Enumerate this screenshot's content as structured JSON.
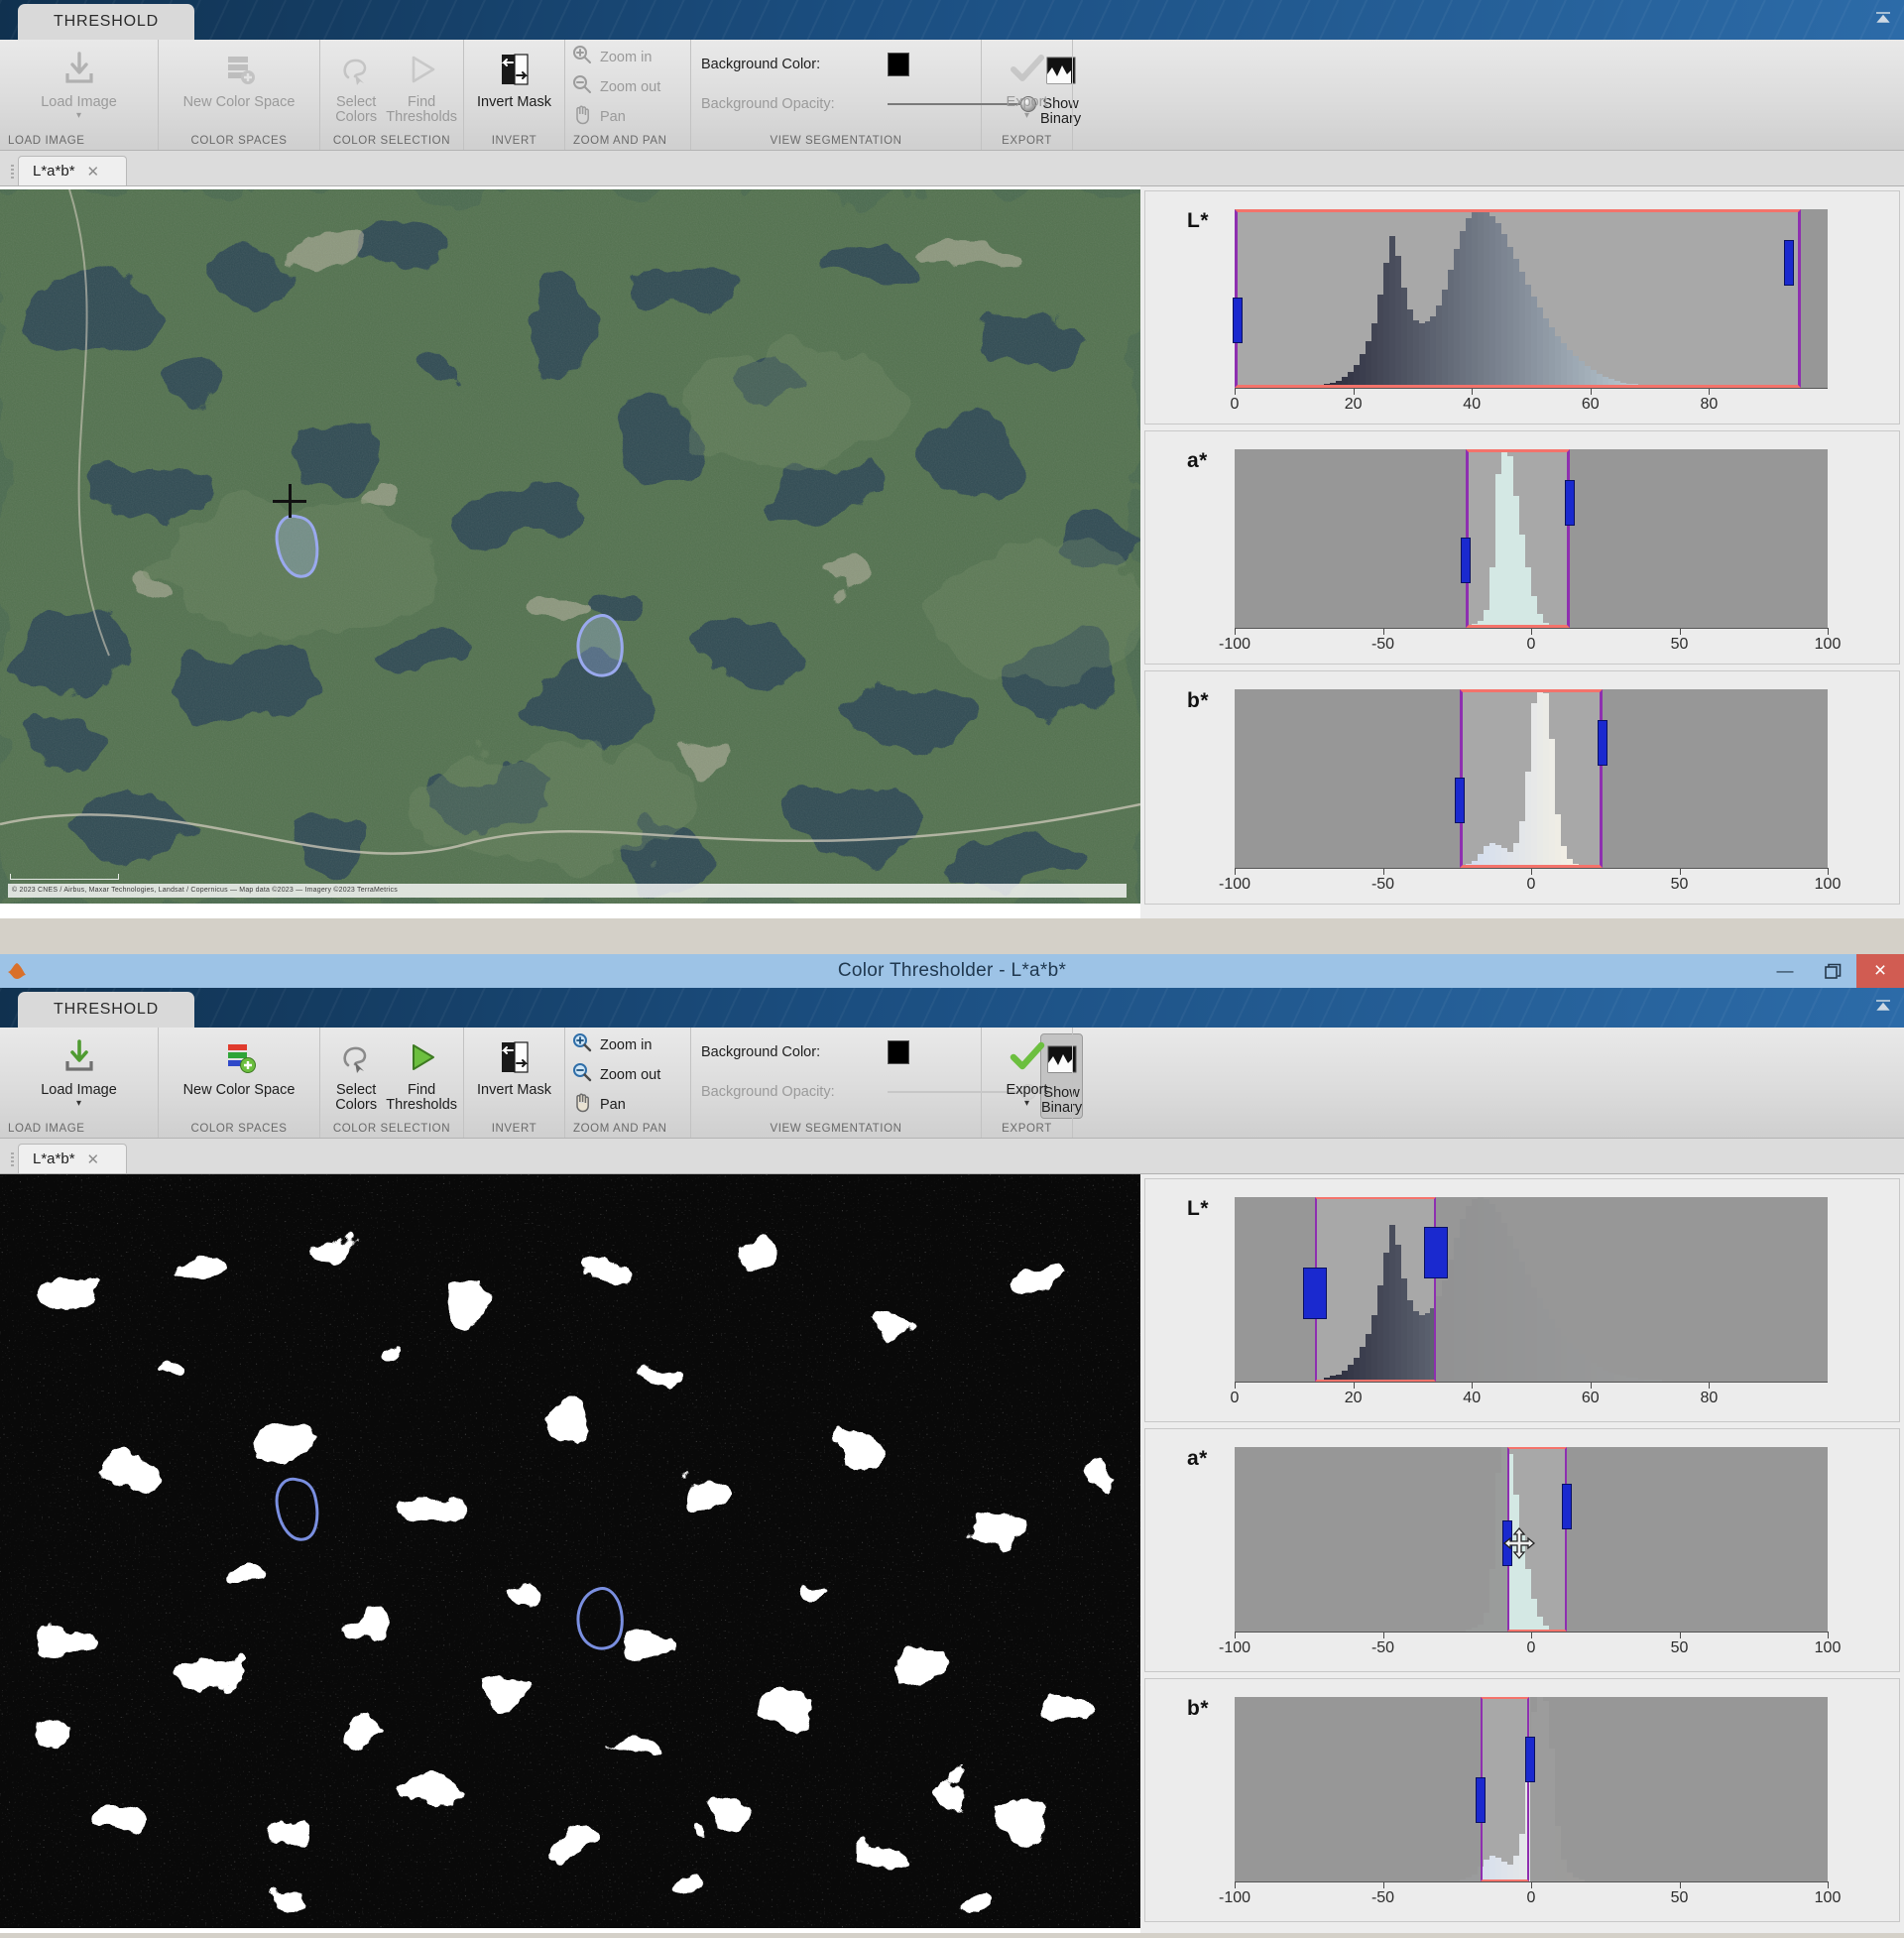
{
  "app": {
    "title": "Color Thresholder - L*a*b*",
    "icon": "matlab-icon"
  },
  "window_controls": {
    "minimize": "—",
    "restore": "restore-icon",
    "close": "×"
  },
  "ribbon": {
    "tab_label": "THRESHOLD",
    "collapse_icon": "collapse-ribbon-icon",
    "groups": [
      {
        "title": "LOAD IMAGE",
        "buttons": [
          {
            "label": "Load Image",
            "icon": "load-image-icon",
            "caret": "▾"
          }
        ]
      },
      {
        "title": "COLOR SPACES",
        "buttons": [
          {
            "label": "New Color Space",
            "icon": "new-color-space-icon"
          }
        ]
      },
      {
        "title": "COLOR SELECTION",
        "buttons": [
          {
            "label": "Select Colors",
            "icon": "select-colors-icon"
          },
          {
            "label": "Find Thresholds",
            "icon": "find-thresholds-icon"
          }
        ]
      },
      {
        "title": "INVERT",
        "buttons": [
          {
            "label": "Invert Mask",
            "icon": "invert-mask-icon"
          }
        ]
      },
      {
        "title": "ZOOM AND PAN",
        "items": [
          {
            "label": "Zoom in",
            "icon": "zoom-in-icon"
          },
          {
            "label": "Zoom out",
            "icon": "zoom-out-icon"
          },
          {
            "label": "Pan",
            "icon": "pan-hand-icon"
          }
        ]
      },
      {
        "title": "VIEW SEGMENTATION",
        "bg_color_label": "Background Color:",
        "bg_color_value": "#000000",
        "bg_opacity_label": "Background Opacity:",
        "show_binary_label": "Show Binary",
        "show_binary_icon": "show-binary-icon"
      },
      {
        "title": "EXPORT",
        "buttons": [
          {
            "label": "Export",
            "icon": "export-check-icon",
            "caret": "▾"
          }
        ]
      }
    ]
  },
  "doc_tab": {
    "label": "L*a*b*",
    "close": "✕"
  },
  "image_view": {
    "top_mode": "satellite-color-image",
    "bottom_mode": "binary-mask-image",
    "attribution": "© 2023 CNES / Airbus, Maxar Technologies, Landsat / Copernicus  —  Map data ©2023  —  Imagery ©2023 TerraMetrics",
    "cursor_top": "crosshair-cursor",
    "roi_shapes": 2
  },
  "chart_data": [
    {
      "id": "top-L",
      "type": "bar",
      "title": "L*",
      "xlabel": "",
      "ylabel": "",
      "xlim": [
        0,
        100
      ],
      "xticks": [
        0,
        20,
        40,
        60,
        80
      ],
      "grid": false,
      "roi": {
        "min": 0,
        "max": 95.5
      },
      "handles": [
        0.5,
        93.5
      ],
      "bin_start": 0,
      "bin_step": 1,
      "values": [
        0,
        0,
        0,
        0,
        0,
        0,
        0,
        0,
        0,
        0,
        0,
        0,
        0,
        0,
        1,
        2,
        3,
        4,
        6,
        9,
        13,
        19,
        26,
        36,
        52,
        70,
        85,
        74,
        56,
        44,
        38,
        36,
        37,
        40,
        46,
        55,
        66,
        78,
        88,
        95,
        99,
        100,
        99,
        96,
        92,
        86,
        79,
        72,
        65,
        58,
        51,
        45,
        39,
        34,
        29,
        25,
        21,
        18,
        15,
        12,
        10,
        8,
        6,
        5,
        4,
        3,
        2,
        2,
        1,
        1,
        1,
        1,
        0,
        0,
        0,
        0,
        0,
        0,
        0,
        0,
        0,
        0,
        0,
        0,
        0,
        0,
        0,
        0,
        0,
        0,
        0,
        0,
        0,
        0,
        0,
        0,
        0,
        0,
        0,
        0
      ]
    },
    {
      "id": "top-a",
      "type": "bar",
      "title": "a*",
      "xlabel": "",
      "ylabel": "",
      "xlim": [
        -100,
        100
      ],
      "xticks": [
        -100,
        -50,
        0,
        50,
        100
      ],
      "grid": false,
      "roi": {
        "min": -22,
        "max": 13
      },
      "handles": [
        -22,
        13
      ],
      "bin_start": -100,
      "bin_step": 2,
      "values": [
        0,
        0,
        0,
        0,
        0,
        0,
        0,
        0,
        0,
        0,
        0,
        0,
        0,
        0,
        0,
        0,
        0,
        0,
        0,
        0,
        0,
        0,
        0,
        0,
        0,
        0,
        0,
        0,
        0,
        0,
        0,
        0,
        0,
        0,
        0,
        0,
        0,
        0,
        0,
        1,
        2,
        4,
        10,
        34,
        86,
        100,
        96,
        74,
        52,
        34,
        18,
        8,
        3,
        1,
        0,
        0,
        0,
        0,
        0,
        0,
        0,
        0,
        0,
        0,
        0,
        0,
        0,
        0,
        0,
        0,
        0,
        0,
        0,
        0,
        0,
        0,
        0,
        0,
        0,
        0,
        0,
        0,
        0,
        0,
        0,
        0,
        0,
        0,
        0,
        0,
        0,
        0,
        0,
        0,
        0,
        0,
        0,
        0,
        0,
        0
      ]
    },
    {
      "id": "top-b",
      "type": "bar",
      "title": "b*",
      "xlabel": "",
      "ylabel": "",
      "xlim": [
        -100,
        100
      ],
      "xticks": [
        -100,
        -50,
        0,
        50,
        100
      ],
      "grid": false,
      "roi": {
        "min": -24,
        "max": 24
      },
      "handles": [
        -24,
        24
      ],
      "bin_start": -100,
      "bin_step": 2,
      "values": [
        0,
        0,
        0,
        0,
        0,
        0,
        0,
        0,
        0,
        0,
        0,
        0,
        0,
        0,
        0,
        0,
        0,
        0,
        0,
        0,
        0,
        0,
        0,
        0,
        0,
        0,
        0,
        0,
        0,
        0,
        0,
        0,
        0,
        0,
        0,
        0,
        0,
        0,
        1,
        2,
        4,
        8,
        12,
        14,
        13,
        11,
        9,
        14,
        26,
        54,
        92,
        100,
        98,
        72,
        30,
        12,
        5,
        2,
        1,
        0,
        0,
        0,
        0,
        0,
        0,
        0,
        0,
        0,
        0,
        0,
        0,
        0,
        0,
        0,
        0,
        0,
        0,
        0,
        0,
        0,
        0,
        0,
        0,
        0,
        0,
        0,
        0,
        0,
        0,
        0,
        0,
        0,
        0,
        0,
        0,
        0,
        0,
        0,
        0,
        0
      ]
    },
    {
      "id": "bottom-L",
      "type": "bar",
      "title": "L*",
      "xlabel": "",
      "ylabel": "",
      "xlim": [
        0,
        100
      ],
      "xticks": [
        0,
        20,
        40,
        60,
        80
      ],
      "grid": false,
      "roi": {
        "min": 13.5,
        "max": 34
      },
      "handles": [
        13.5,
        34
      ],
      "bin_start": 0,
      "bin_step": 1,
      "values": [
        0,
        0,
        0,
        0,
        0,
        0,
        0,
        0,
        0,
        0,
        0,
        0,
        0,
        0,
        1,
        2,
        3,
        4,
        6,
        9,
        13,
        19,
        26,
        36,
        52,
        70,
        85,
        74,
        56,
        44,
        38,
        36,
        37,
        40,
        46,
        55,
        66,
        78,
        88,
        95,
        99,
        100,
        99,
        96,
        92,
        86,
        79,
        72,
        65,
        58,
        51,
        45,
        39,
        34,
        29,
        25,
        21,
        18,
        15,
        12,
        10,
        8,
        6,
        5,
        4,
        3,
        2,
        2,
        1,
        1,
        1,
        1,
        0,
        0,
        0,
        0,
        0,
        0,
        0,
        0,
        0,
        0,
        0,
        0,
        0,
        0,
        0,
        0,
        0,
        0,
        0,
        0,
        0,
        0,
        0,
        0,
        0,
        0,
        0,
        0
      ]
    },
    {
      "id": "bottom-a",
      "type": "bar",
      "title": "a*",
      "xlabel": "",
      "ylabel": "",
      "xlim": [
        -100,
        100
      ],
      "xticks": [
        -100,
        -50,
        0,
        50,
        100
      ],
      "grid": false,
      "roi": {
        "min": -8,
        "max": 12
      },
      "handles": [
        -8,
        12
      ],
      "bin_start": -100,
      "bin_step": 2,
      "values": [
        0,
        0,
        0,
        0,
        0,
        0,
        0,
        0,
        0,
        0,
        0,
        0,
        0,
        0,
        0,
        0,
        0,
        0,
        0,
        0,
        0,
        0,
        0,
        0,
        0,
        0,
        0,
        0,
        0,
        0,
        0,
        0,
        0,
        0,
        0,
        0,
        0,
        0,
        0,
        1,
        2,
        4,
        10,
        34,
        86,
        100,
        96,
        74,
        52,
        34,
        18,
        8,
        3,
        1,
        0,
        0,
        0,
        0,
        0,
        0,
        0,
        0,
        0,
        0,
        0,
        0,
        0,
        0,
        0,
        0,
        0,
        0,
        0,
        0,
        0,
        0,
        0,
        0,
        0,
        0,
        0,
        0,
        0,
        0,
        0,
        0,
        0,
        0,
        0,
        0,
        0,
        0,
        0,
        0,
        0,
        0,
        0,
        0,
        0,
        0
      ],
      "cursor": "move-cursor"
    },
    {
      "id": "bottom-b",
      "type": "bar",
      "title": "b*",
      "xlabel": "",
      "ylabel": "",
      "xlim": [
        -100,
        100
      ],
      "xticks": [
        -100,
        -50,
        0,
        50,
        100
      ],
      "grid": false,
      "roi": {
        "min": -17,
        "max": -0.5
      },
      "handles": [
        -17,
        -0.5
      ],
      "bin_start": -100,
      "bin_step": 2,
      "values": [
        0,
        0,
        0,
        0,
        0,
        0,
        0,
        0,
        0,
        0,
        0,
        0,
        0,
        0,
        0,
        0,
        0,
        0,
        0,
        0,
        0,
        0,
        0,
        0,
        0,
        0,
        0,
        0,
        0,
        0,
        0,
        0,
        0,
        0,
        0,
        0,
        0,
        0,
        1,
        2,
        4,
        8,
        12,
        14,
        13,
        11,
        9,
        14,
        26,
        54,
        92,
        100,
        98,
        72,
        30,
        12,
        5,
        2,
        1,
        0,
        0,
        0,
        0,
        0,
        0,
        0,
        0,
        0,
        0,
        0,
        0,
        0,
        0,
        0,
        0,
        0,
        0,
        0,
        0,
        0,
        0,
        0,
        0,
        0,
        0,
        0,
        0,
        0,
        0,
        0,
        0,
        0,
        0,
        0,
        0,
        0,
        0,
        0,
        0,
        0
      ]
    }
  ]
}
